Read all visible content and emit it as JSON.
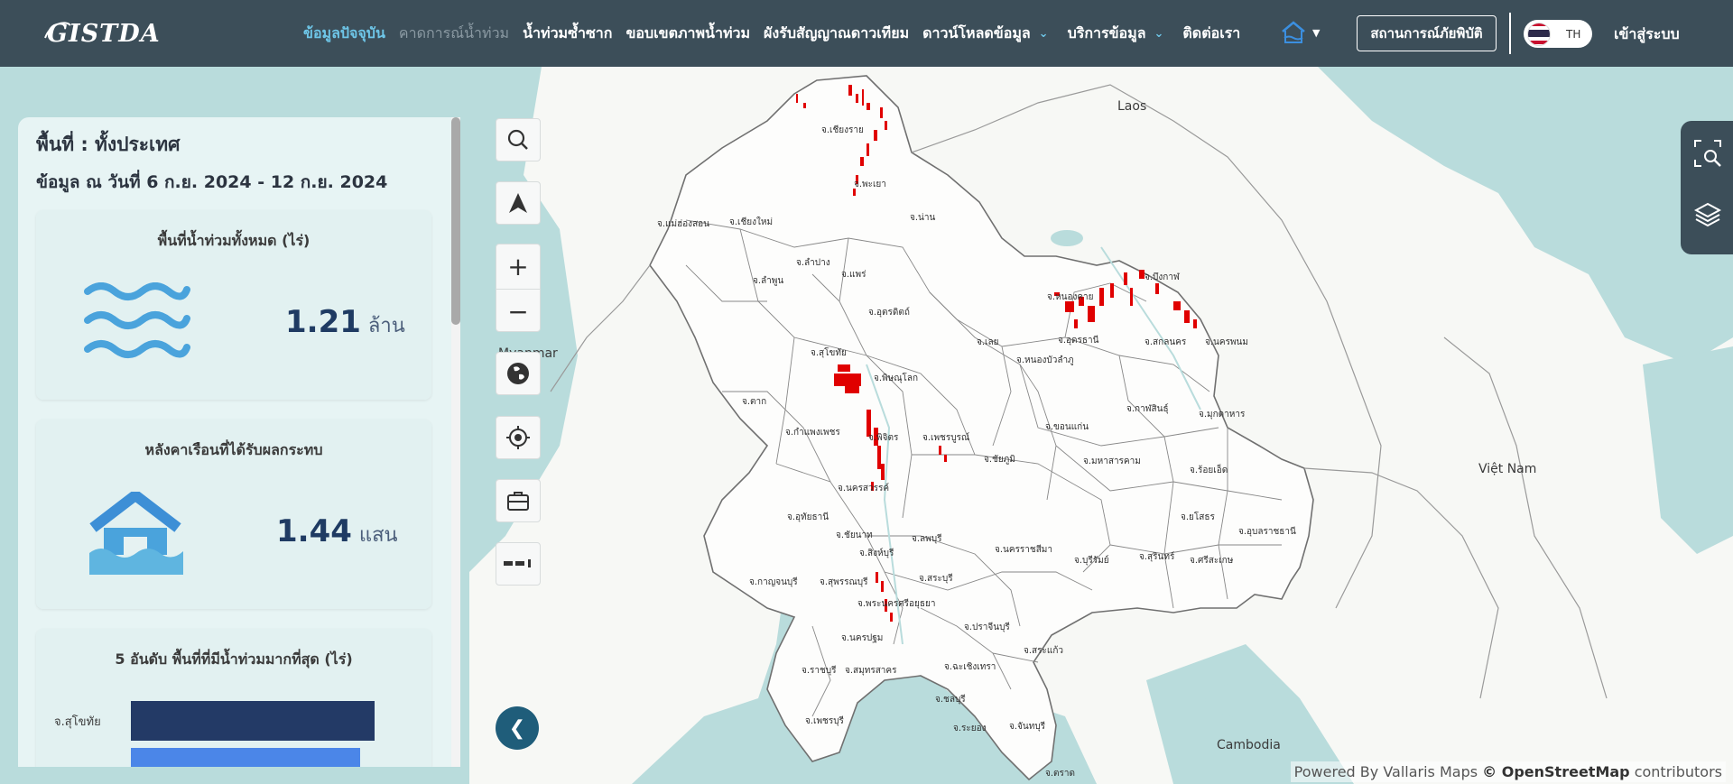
{
  "app": {
    "logo_text": "GISTDA"
  },
  "nav": {
    "items": [
      {
        "label": "ข้อมูลปัจจุบัน",
        "state": "active"
      },
      {
        "label": "คาดการณ์น้ำท่วม",
        "state": "disabled"
      },
      {
        "label": "น้ำท่วมซ้ำซาก",
        "state": "normal"
      },
      {
        "label": "ขอบเขตภาพน้ำท่วม",
        "state": "normal"
      },
      {
        "label": "ผังรับสัญญาณดาวเทียม",
        "state": "normal"
      },
      {
        "label": "ดาวน์โหลดข้อมูล",
        "state": "dropdown"
      },
      {
        "label": "บริการข้อมูล",
        "state": "dropdown"
      },
      {
        "label": "ติดต่อเรา",
        "state": "normal"
      }
    ],
    "home_icon": "home-icon",
    "disaster_button": "สถานการณ์ภัยพิบัติ",
    "language": "TH",
    "login": "เข้าสู่ระบบ"
  },
  "panel": {
    "area_label": "พื้นที่ : ทั้งประเทศ",
    "date_label": "ข้อมูล ณ วันที่ 6 ก.ย. 2024 - 12 ก.ย. 2024",
    "flood_card": {
      "title": "พื้นที่น้ำท่วมทั้งหมด (ไร่)",
      "value": "1.21",
      "unit": "ล้าน",
      "icon": "water-waves-icon"
    },
    "house_card": {
      "title": "หลังคาเรือนที่ได้รับผลกระทบ",
      "value": "1.44",
      "unit": "แสน",
      "icon": "flooded-house-icon"
    },
    "rank_card": {
      "title": "5 อันดับ พื้นที่ที่มีน้ำท่วมมากที่สุด (ไร่)",
      "rows": [
        {
          "label": "จ.สุโขทัย",
          "fraction": 1.0,
          "color": "#233a66"
        },
        {
          "label": "",
          "fraction": 0.94,
          "color": "#4b86e8"
        }
      ]
    }
  },
  "tools": {
    "search_icon": "search-icon",
    "navigate_icon": "navigation-arrow-icon",
    "zoom_in": "+",
    "zoom_out": "−",
    "basemap_icon": "globe-icon",
    "locate_icon": "crosshair-icon",
    "toolbox_icon": "briefcase-icon",
    "measure_icon": "measure-icon",
    "collapse_icon": "chevron-left-icon"
  },
  "right_tabs": {
    "area_search_icon": "area-search-icon",
    "layers_icon": "layers-icon"
  },
  "map": {
    "places": [
      "Laos",
      "Myanmar",
      "Việt Nam",
      "Cambodia"
    ],
    "provinces": [
      "จ.เชียงราย",
      "จ.พะเยา",
      "จ.แม่ฮ่องสอน",
      "จ.เชียงใหม่",
      "จ.น่าน",
      "จ.ลำปาง",
      "จ.ลำพูน",
      "จ.แพร่",
      "จ.อุตรดิตถ์",
      "จ.บึงกาฬ",
      "จ.หนองคาย",
      "จ.อุดรธานี",
      "จ.สกลนคร",
      "จ.นครพนม",
      "จ.เลย",
      "จ.หนองบัวลำภู",
      "จ.สุโขทัย",
      "จ.พิษณุโลก",
      "จ.ตาก",
      "จ.กาฬสินธุ์",
      "จ.มุกดาหาร",
      "จ.ขอนแก่น",
      "จ.กำแพงเพชร",
      "จ.พิจิตร",
      "จ.เพชรบูรณ์",
      "จ.ชัยภูมิ",
      "จ.มหาสารคาม",
      "จ.ร้อยเอ็ด",
      "จ.นครสวรรค์",
      "จ.อุทัยธานี",
      "จ.ยโสธร",
      "จ.อุบลราชธานี",
      "จ.ชัยนาท",
      "จ.ลพบุรี",
      "จ.สิงห์บุรี",
      "จ.นครราชสีมา",
      "จ.บุรีรัมย์",
      "จ.สุรินทร์",
      "จ.ศรีสะเกษ",
      "จ.สุพรรณบุรี",
      "จ.สระบุรี",
      "จ.กาญจนบุรี",
      "จ.พระนครศรีอยุธยา",
      "จ.ปราจีนบุรี",
      "จ.นครปฐม",
      "จ.สระแก้ว",
      "จ.ราชบุรี",
      "จ.สมุทรสาคร",
      "จ.ฉะเชิงเทรา",
      "จ.ชลบุรี",
      "จ.เพชรบุรี",
      "จ.ระยอง",
      "จ.จันทบุรี",
      "จ.ตราด"
    ],
    "attribution_prefix": "Powered By Vallaris Maps",
    "attribution_osm": "© OpenStreetMap",
    "attribution_suffix": "contributors"
  }
}
